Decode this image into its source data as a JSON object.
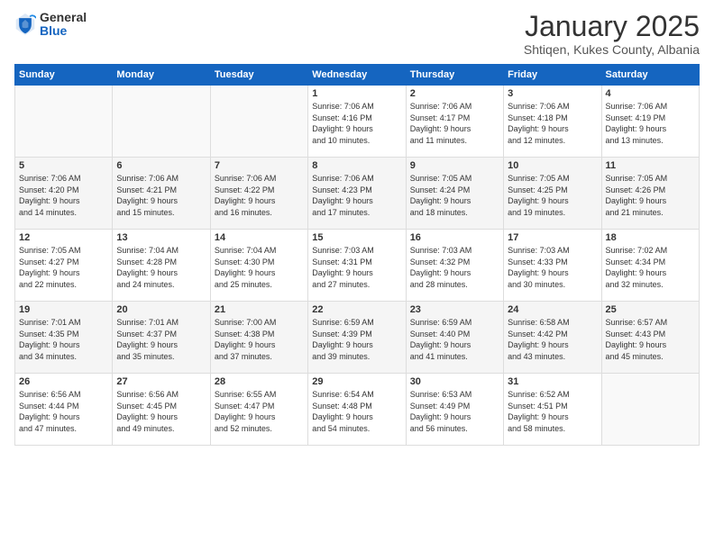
{
  "logo": {
    "general": "General",
    "blue": "Blue"
  },
  "header": {
    "month": "January 2025",
    "location": "Shtiqen, Kukes County, Albania"
  },
  "days_of_week": [
    "Sunday",
    "Monday",
    "Tuesday",
    "Wednesday",
    "Thursday",
    "Friday",
    "Saturday"
  ],
  "weeks": [
    [
      {
        "day": "",
        "info": ""
      },
      {
        "day": "",
        "info": ""
      },
      {
        "day": "",
        "info": ""
      },
      {
        "day": "1",
        "info": "Sunrise: 7:06 AM\nSunset: 4:16 PM\nDaylight: 9 hours\nand 10 minutes."
      },
      {
        "day": "2",
        "info": "Sunrise: 7:06 AM\nSunset: 4:17 PM\nDaylight: 9 hours\nand 11 minutes."
      },
      {
        "day": "3",
        "info": "Sunrise: 7:06 AM\nSunset: 4:18 PM\nDaylight: 9 hours\nand 12 minutes."
      },
      {
        "day": "4",
        "info": "Sunrise: 7:06 AM\nSunset: 4:19 PM\nDaylight: 9 hours\nand 13 minutes."
      }
    ],
    [
      {
        "day": "5",
        "info": "Sunrise: 7:06 AM\nSunset: 4:20 PM\nDaylight: 9 hours\nand 14 minutes."
      },
      {
        "day": "6",
        "info": "Sunrise: 7:06 AM\nSunset: 4:21 PM\nDaylight: 9 hours\nand 15 minutes."
      },
      {
        "day": "7",
        "info": "Sunrise: 7:06 AM\nSunset: 4:22 PM\nDaylight: 9 hours\nand 16 minutes."
      },
      {
        "day": "8",
        "info": "Sunrise: 7:06 AM\nSunset: 4:23 PM\nDaylight: 9 hours\nand 17 minutes."
      },
      {
        "day": "9",
        "info": "Sunrise: 7:05 AM\nSunset: 4:24 PM\nDaylight: 9 hours\nand 18 minutes."
      },
      {
        "day": "10",
        "info": "Sunrise: 7:05 AM\nSunset: 4:25 PM\nDaylight: 9 hours\nand 19 minutes."
      },
      {
        "day": "11",
        "info": "Sunrise: 7:05 AM\nSunset: 4:26 PM\nDaylight: 9 hours\nand 21 minutes."
      }
    ],
    [
      {
        "day": "12",
        "info": "Sunrise: 7:05 AM\nSunset: 4:27 PM\nDaylight: 9 hours\nand 22 minutes."
      },
      {
        "day": "13",
        "info": "Sunrise: 7:04 AM\nSunset: 4:28 PM\nDaylight: 9 hours\nand 24 minutes."
      },
      {
        "day": "14",
        "info": "Sunrise: 7:04 AM\nSunset: 4:30 PM\nDaylight: 9 hours\nand 25 minutes."
      },
      {
        "day": "15",
        "info": "Sunrise: 7:03 AM\nSunset: 4:31 PM\nDaylight: 9 hours\nand 27 minutes."
      },
      {
        "day": "16",
        "info": "Sunrise: 7:03 AM\nSunset: 4:32 PM\nDaylight: 9 hours\nand 28 minutes."
      },
      {
        "day": "17",
        "info": "Sunrise: 7:03 AM\nSunset: 4:33 PM\nDaylight: 9 hours\nand 30 minutes."
      },
      {
        "day": "18",
        "info": "Sunrise: 7:02 AM\nSunset: 4:34 PM\nDaylight: 9 hours\nand 32 minutes."
      }
    ],
    [
      {
        "day": "19",
        "info": "Sunrise: 7:01 AM\nSunset: 4:35 PM\nDaylight: 9 hours\nand 34 minutes."
      },
      {
        "day": "20",
        "info": "Sunrise: 7:01 AM\nSunset: 4:37 PM\nDaylight: 9 hours\nand 35 minutes."
      },
      {
        "day": "21",
        "info": "Sunrise: 7:00 AM\nSunset: 4:38 PM\nDaylight: 9 hours\nand 37 minutes."
      },
      {
        "day": "22",
        "info": "Sunrise: 6:59 AM\nSunset: 4:39 PM\nDaylight: 9 hours\nand 39 minutes."
      },
      {
        "day": "23",
        "info": "Sunrise: 6:59 AM\nSunset: 4:40 PM\nDaylight: 9 hours\nand 41 minutes."
      },
      {
        "day": "24",
        "info": "Sunrise: 6:58 AM\nSunset: 4:42 PM\nDaylight: 9 hours\nand 43 minutes."
      },
      {
        "day": "25",
        "info": "Sunrise: 6:57 AM\nSunset: 4:43 PM\nDaylight: 9 hours\nand 45 minutes."
      }
    ],
    [
      {
        "day": "26",
        "info": "Sunrise: 6:56 AM\nSunset: 4:44 PM\nDaylight: 9 hours\nand 47 minutes."
      },
      {
        "day": "27",
        "info": "Sunrise: 6:56 AM\nSunset: 4:45 PM\nDaylight: 9 hours\nand 49 minutes."
      },
      {
        "day": "28",
        "info": "Sunrise: 6:55 AM\nSunset: 4:47 PM\nDaylight: 9 hours\nand 52 minutes."
      },
      {
        "day": "29",
        "info": "Sunrise: 6:54 AM\nSunset: 4:48 PM\nDaylight: 9 hours\nand 54 minutes."
      },
      {
        "day": "30",
        "info": "Sunrise: 6:53 AM\nSunset: 4:49 PM\nDaylight: 9 hours\nand 56 minutes."
      },
      {
        "day": "31",
        "info": "Sunrise: 6:52 AM\nSunset: 4:51 PM\nDaylight: 9 hours\nand 58 minutes."
      },
      {
        "day": "",
        "info": ""
      }
    ]
  ]
}
